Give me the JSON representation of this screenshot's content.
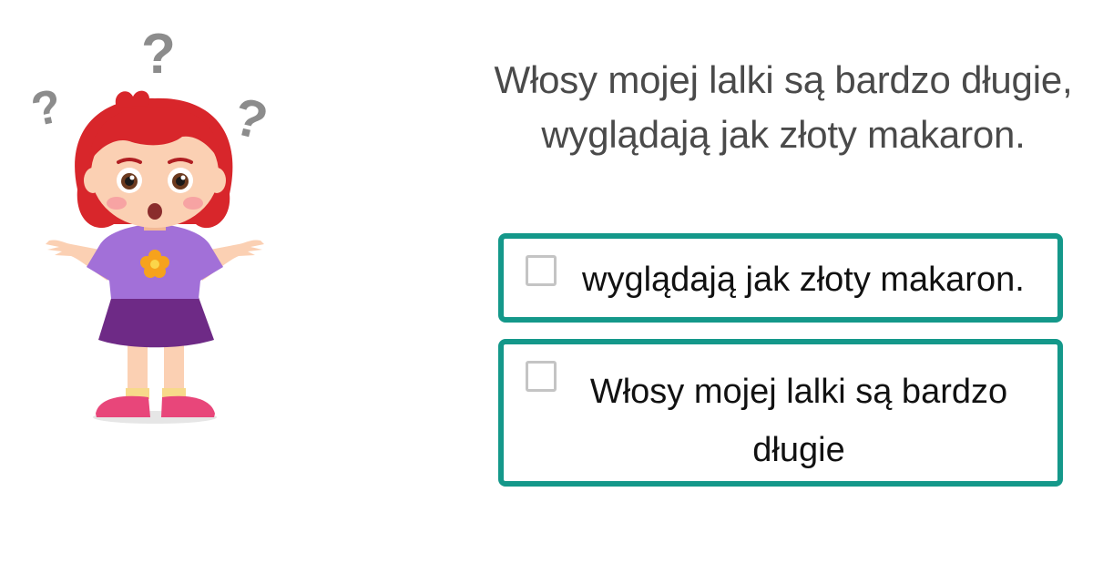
{
  "question": {
    "line1": "Włosy mojej lalki są bardzo długie,",
    "line2": "wyglądają jak złoty makaron."
  },
  "options": [
    {
      "label": "wyglądają jak złoty makaron.",
      "checked": false
    },
    {
      "label": "Włosy mojej lalki są bardzo długie",
      "checked": false
    }
  ],
  "colors": {
    "option_border": "#14988a",
    "question_text": "#4a4a4a",
    "option_text": "#111111",
    "checkbox_border": "#c4c4c4"
  },
  "illustration": {
    "icon": "confused-girl-illustration",
    "question_mark_count": 3
  }
}
